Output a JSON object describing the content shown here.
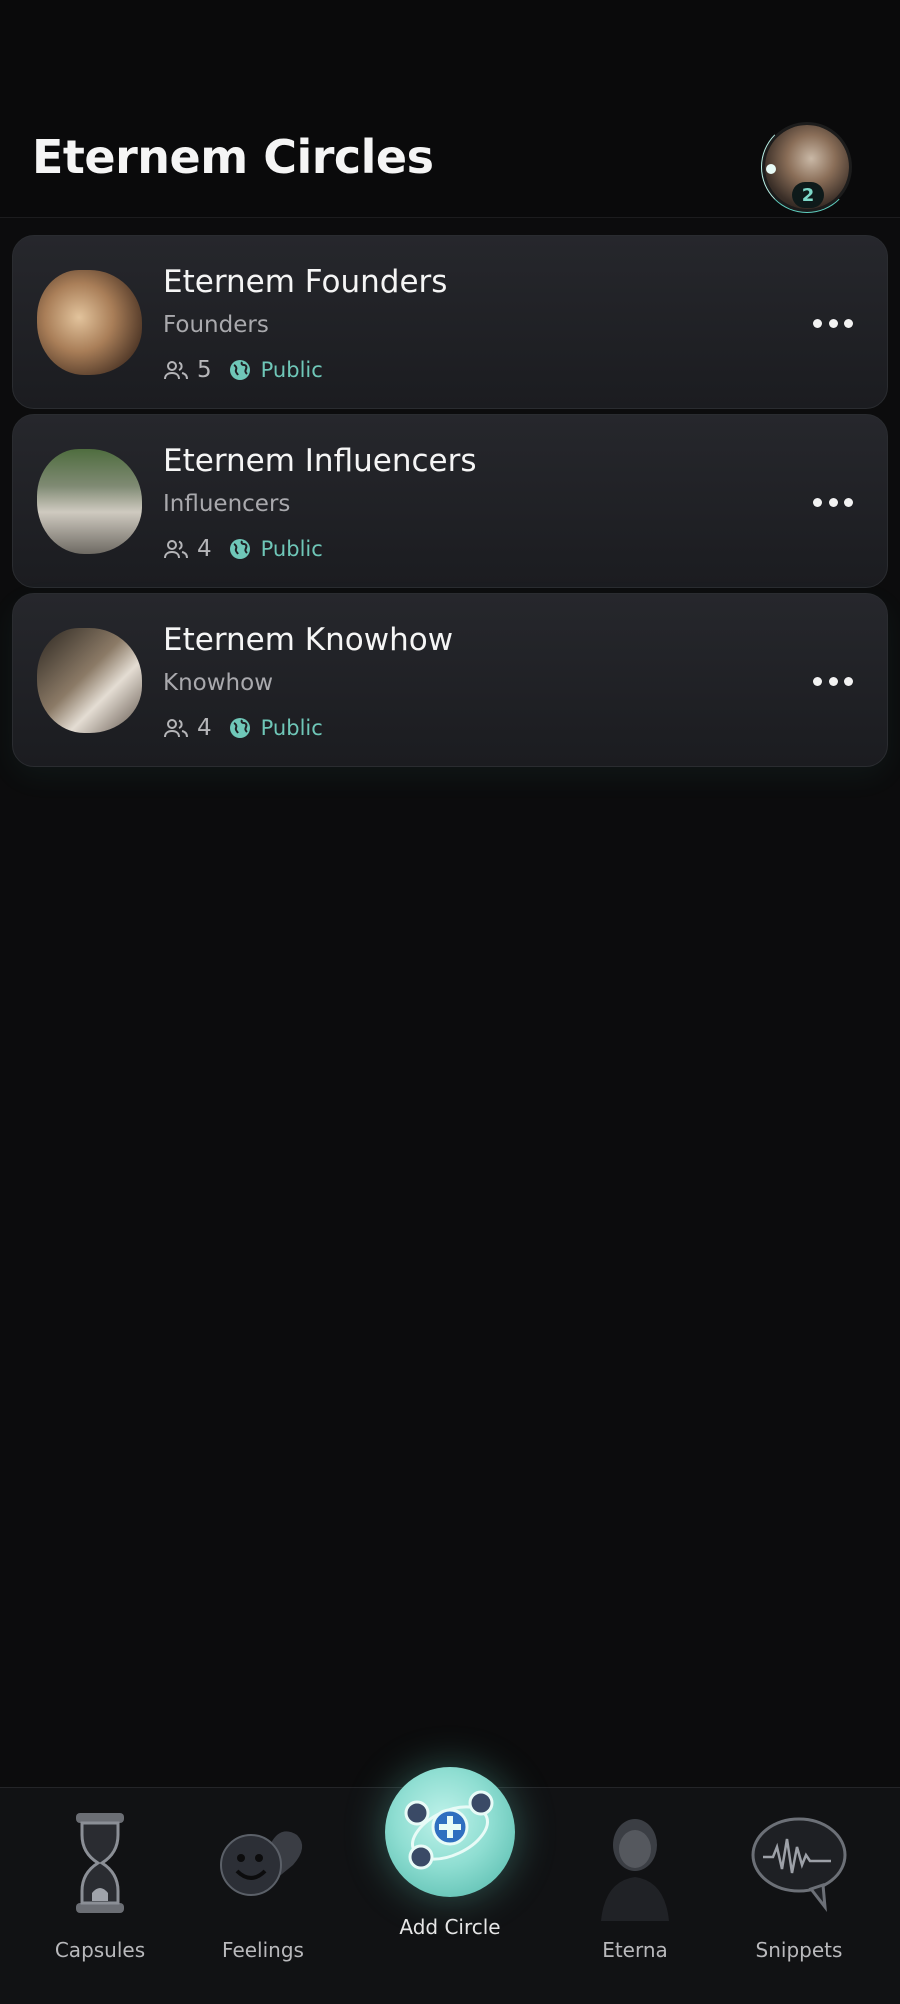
{
  "header": {
    "title": "Eternem Circles",
    "notification_count": "2"
  },
  "circles": [
    {
      "name": "Eternem Founders",
      "subtitle": "Founders",
      "members": "5",
      "visibility": "Public"
    },
    {
      "name": "Eternem Influencers",
      "subtitle": "Influencers",
      "members": "4",
      "visibility": "Public"
    },
    {
      "name": "Eternem Knowhow",
      "subtitle": "Knowhow",
      "members": "4",
      "visibility": "Public"
    }
  ],
  "nav": {
    "capsules": "Capsules",
    "feelings": "Feelings",
    "add_circle": "Add Circle",
    "eterna": "Eterna",
    "snippets": "Snippets"
  },
  "colors": {
    "background": "#0c0c0d",
    "card": "#222328",
    "accent": "#6fc7b8",
    "add_button": "#8fded2"
  },
  "icons": [
    "members-icon",
    "globe-icon",
    "more-icon",
    "hourglass-icon",
    "heart-smiley-icon",
    "circle-network-icon",
    "avatar-icon",
    "speech-waveform-icon"
  ]
}
